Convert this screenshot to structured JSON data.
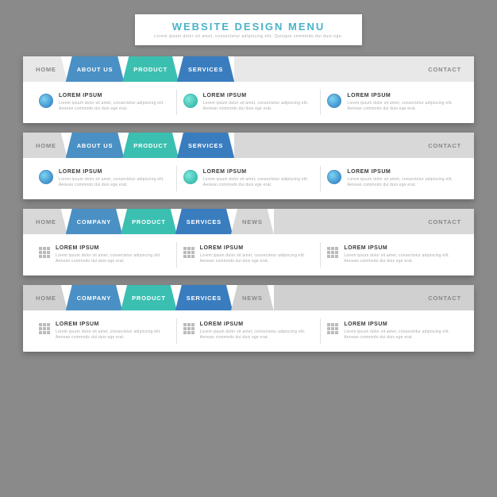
{
  "title": {
    "heading": "WEBSITE DESIGN MENU",
    "subtitle": "Lorem ipsum dolor sit amet, consectetur adipiscing elit. Quisque commodo dui duis ege."
  },
  "menus": [
    {
      "id": "menu1",
      "version": "v1",
      "tabs": [
        "HOME",
        "ABOUT US",
        "PRODUCT",
        "SERVICES",
        "CONTACT"
      ],
      "content_cols": [
        {
          "title": "LOREM IPSUM",
          "desc": "Lorem ipsum dolor sit amet, consectetur adipiscing elit.\nAenean commodo dui duis ege erat."
        },
        {
          "title": "LOREM IPSUM",
          "desc": "Lorem ipsum dolor sit amet, consectetur adipiscing elit.\nAenean commodo dui duis ege erat."
        },
        {
          "title": "LOREM IPSUM",
          "desc": "Lorem ipsum dolor sit amet, consectetur adipiscing elit.\nAenean commodo dui duis ege erat."
        }
      ]
    },
    {
      "id": "menu2",
      "version": "v2",
      "tabs": [
        "HOME",
        "ABOUT US",
        "PRODUCT",
        "SERVICES",
        "CONTACT"
      ],
      "content_cols": [
        {
          "title": "LOREM IPSUM",
          "desc": "Lorem ipsum dolor sit amet, consectetur adipiscing elit.\nAenean commodo dui duis ege erat."
        },
        {
          "title": "LOREM IPSUM",
          "desc": "Lorem ipsum dolor sit amet, consectetur adipiscing elit.\nAenean commodo dui duis ege erat."
        },
        {
          "title": "LOREM IPSUM",
          "desc": "Lorem ipsum dolor sit amet, consectetur adipiscing elit.\nAenean commodo dui duis ege erat."
        }
      ]
    },
    {
      "id": "menu3",
      "version": "v3",
      "tabs": [
        "HOME",
        "COMPANY",
        "PRODUCT",
        "SERVICES",
        "NEWS",
        "CONTACT"
      ],
      "content_cols": [
        {
          "title": "LOREM IPSUM",
          "desc": "Lorem ipsum dolor sit amet, consectetur adipiscing elit.\nAenean commodo dui duis ege erat."
        },
        {
          "title": "LOREM IPSUM",
          "desc": "Lorem ipsum dolor sit amet, consectetur adipiscing elit.\nAenean commodo dui duis ege erat."
        },
        {
          "title": "LOREM IPSUM",
          "desc": "Lorem ipsum dolor sit amet, consectetur adipiscing elit.\nAenean commodo dui duis ege erat."
        }
      ]
    },
    {
      "id": "menu4",
      "version": "v4",
      "tabs": [
        "HOME",
        "COMPANY",
        "PRODUCT",
        "SERVICES",
        "NEWS",
        "CONTACT"
      ],
      "content_cols": [
        {
          "title": "LOREM IPSUM",
          "desc": "Lorem ipsum dolor sit amet, consectetur adipiscing elit.\nAenean commodo dui duis ege erat."
        },
        {
          "title": "LOREM IPSUM",
          "desc": "Lorem ipsum dolor sit amet, consectetur adipiscing elit.\nAenean commodo dui duis ege erat."
        },
        {
          "title": "LOREM IPSUM",
          "desc": "Lorem ipsum dolor sit amet, consectetur adipiscing elit.\nAenean commodo dui duis ege erat."
        }
      ]
    }
  ]
}
